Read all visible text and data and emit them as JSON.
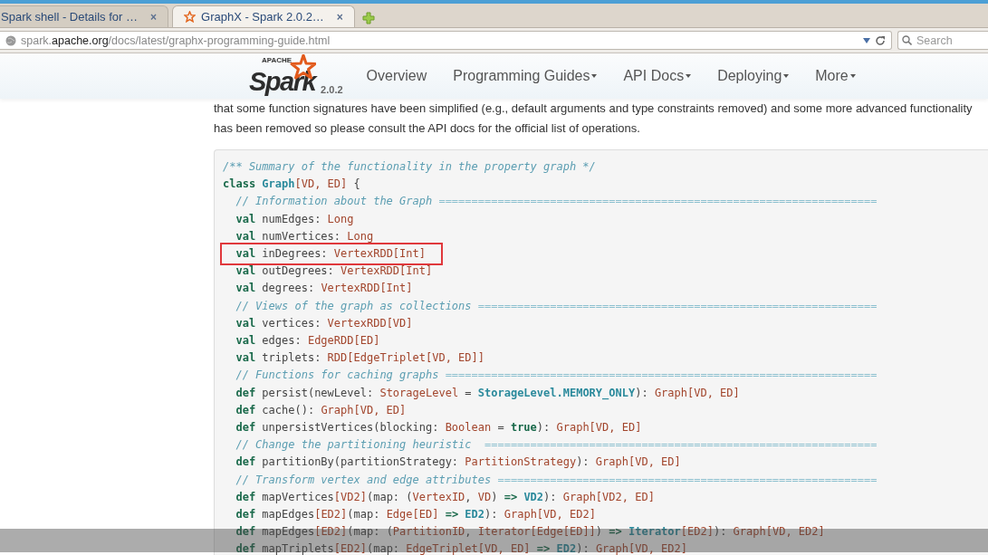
{
  "browser": {
    "tabs": [
      {
        "title": "Spark shell - Details for …",
        "close": "×",
        "selected": false,
        "favicon": false
      },
      {
        "title": "GraphX - Spark 2.0.2…",
        "close": "×",
        "selected": true,
        "favicon": true
      }
    ],
    "address": "spark.**apache.org**/docs/latest/graphx-programming-guide.html",
    "search": {
      "placeholder": "Search"
    }
  },
  "navbar": {
    "logo": {
      "brand": "APACHE",
      "name": "Spark",
      "version": "2.0.2"
    },
    "items": [
      {
        "label": "Overview",
        "dropdown": false
      },
      {
        "label": "Programming Guides",
        "dropdown": true
      },
      {
        "label": "API Docs",
        "dropdown": true
      },
      {
        "label": "Deploying",
        "dropdown": true
      },
      {
        "label": "More",
        "dropdown": true
      }
    ]
  },
  "paragraph_lines": [
    "that some function signatures have been simplified (e.g., default arguments and type constraints removed) and some more advanced functionality",
    "has been removed so please consult the API docs for the official list of operations."
  ],
  "code": {
    "lines": [
      {
        "boxed": false,
        "tokens": [
          {
            "text": "/** Summary of the functionality in the property graph */",
            "kind": "comment"
          }
        ]
      },
      {
        "boxed": false,
        "tokens": [
          {
            "text": "class ",
            "kind": "keyword"
          },
          {
            "text": "Graph",
            "kind": "name"
          },
          {
            "text": "[VD, ED]",
            "kind": "type"
          },
          {
            "text": " {",
            "kind": "plain"
          }
        ]
      },
      {
        "boxed": false,
        "tokens": [
          {
            "text": "  // Information about the Graph ",
            "kind": "comment"
          },
          {
            "text": "===================================================================",
            "kind": "rule"
          }
        ]
      },
      {
        "boxed": false,
        "tokens": [
          {
            "text": "  val",
            "kind": "keyword"
          },
          {
            "text": " numEdges: ",
            "kind": "plain"
          },
          {
            "text": "Long",
            "kind": "type"
          }
        ]
      },
      {
        "boxed": false,
        "tokens": [
          {
            "text": "  val",
            "kind": "keyword"
          },
          {
            "text": " numVertices: ",
            "kind": "plain"
          },
          {
            "text": "Long",
            "kind": "type"
          }
        ]
      },
      {
        "boxed": true,
        "tokens": [
          {
            "text": "  val",
            "kind": "keyword"
          },
          {
            "text": " inDegrees: ",
            "kind": "plain"
          },
          {
            "text": "VertexRDD[Int]",
            "kind": "type"
          }
        ]
      },
      {
        "boxed": false,
        "tokens": [
          {
            "text": "  val",
            "kind": "keyword"
          },
          {
            "text": " outDegrees: ",
            "kind": "plain"
          },
          {
            "text": "VertexRDD[Int]",
            "kind": "type"
          }
        ]
      },
      {
        "boxed": false,
        "tokens": [
          {
            "text": "  val",
            "kind": "keyword"
          },
          {
            "text": " degrees: ",
            "kind": "plain"
          },
          {
            "text": "VertexRDD[Int]",
            "kind": "type"
          }
        ]
      },
      {
        "boxed": false,
        "tokens": [
          {
            "text": "  // Views of the graph as collections ",
            "kind": "comment"
          },
          {
            "text": "=============================================================",
            "kind": "rule"
          }
        ]
      },
      {
        "boxed": false,
        "tokens": [
          {
            "text": "  val",
            "kind": "keyword"
          },
          {
            "text": " vertices: ",
            "kind": "plain"
          },
          {
            "text": "VertexRDD[VD]",
            "kind": "type"
          }
        ]
      },
      {
        "boxed": false,
        "tokens": [
          {
            "text": "  val",
            "kind": "keyword"
          },
          {
            "text": " edges: ",
            "kind": "plain"
          },
          {
            "text": "EdgeRDD[ED]",
            "kind": "type"
          }
        ]
      },
      {
        "boxed": false,
        "tokens": [
          {
            "text": "  val",
            "kind": "keyword"
          },
          {
            "text": " triplets: ",
            "kind": "plain"
          },
          {
            "text": "RDD[EdgeTriplet[VD, ED]]",
            "kind": "type"
          }
        ]
      },
      {
        "boxed": false,
        "tokens": [
          {
            "text": "  // Functions for caching graphs ",
            "kind": "comment"
          },
          {
            "text": "==================================================================",
            "kind": "rule"
          }
        ]
      },
      {
        "boxed": false,
        "tokens": [
          {
            "text": "  def",
            "kind": "keyword"
          },
          {
            "text": " persist(newLevel: ",
            "kind": "plain"
          },
          {
            "text": "StorageLevel",
            "kind": "type"
          },
          {
            "text": " = ",
            "kind": "plain"
          },
          {
            "text": "StorageLevel.MEMORY_ONLY",
            "kind": "name"
          },
          {
            "text": "): ",
            "kind": "plain"
          },
          {
            "text": "Graph[VD, ED]",
            "kind": "type"
          }
        ]
      },
      {
        "boxed": false,
        "tokens": [
          {
            "text": "  def",
            "kind": "keyword"
          },
          {
            "text": " cache(): ",
            "kind": "plain"
          },
          {
            "text": "Graph[VD, ED]",
            "kind": "type"
          }
        ]
      },
      {
        "boxed": false,
        "tokens": [
          {
            "text": "  def",
            "kind": "keyword"
          },
          {
            "text": " unpersistVertices(blocking: ",
            "kind": "plain"
          },
          {
            "text": "Boolean",
            "kind": "type"
          },
          {
            "text": " = ",
            "kind": "plain"
          },
          {
            "text": "true",
            "kind": "keyword"
          },
          {
            "text": "): ",
            "kind": "plain"
          },
          {
            "text": "Graph[VD, ED]",
            "kind": "type"
          }
        ]
      },
      {
        "boxed": false,
        "tokens": [
          {
            "text": "  // Change the partitioning heuristic  ",
            "kind": "comment"
          },
          {
            "text": "============================================================",
            "kind": "rule"
          }
        ]
      },
      {
        "boxed": false,
        "tokens": [
          {
            "text": "  def",
            "kind": "keyword"
          },
          {
            "text": " partitionBy(partitionStrategy: ",
            "kind": "plain"
          },
          {
            "text": "PartitionStrategy",
            "kind": "type"
          },
          {
            "text": "): ",
            "kind": "plain"
          },
          {
            "text": "Graph[VD, ED]",
            "kind": "type"
          }
        ]
      },
      {
        "boxed": false,
        "tokens": [
          {
            "text": "  // Transform vertex and edge attributes ",
            "kind": "comment"
          },
          {
            "text": "==========================================================",
            "kind": "rule"
          }
        ]
      },
      {
        "boxed": false,
        "tokens": [
          {
            "text": "  def",
            "kind": "keyword"
          },
          {
            "text": " mapVertices",
            "kind": "plain"
          },
          {
            "text": "[VD2]",
            "kind": "type"
          },
          {
            "text": "(map: (",
            "kind": "plain"
          },
          {
            "text": "VertexID",
            "kind": "type"
          },
          {
            "text": ", ",
            "kind": "plain"
          },
          {
            "text": "VD",
            "kind": "type"
          },
          {
            "text": ") ",
            "kind": "plain"
          },
          {
            "text": "=> ",
            "kind": "keyword"
          },
          {
            "text": "VD2",
            "kind": "name"
          },
          {
            "text": "): ",
            "kind": "plain"
          },
          {
            "text": "Graph[VD2, ED]",
            "kind": "type"
          }
        ]
      },
      {
        "boxed": false,
        "tokens": [
          {
            "text": "  def",
            "kind": "keyword"
          },
          {
            "text": " mapEdges",
            "kind": "plain"
          },
          {
            "text": "[ED2]",
            "kind": "type"
          },
          {
            "text": "(map: ",
            "kind": "plain"
          },
          {
            "text": "Edge[ED] ",
            "kind": "type"
          },
          {
            "text": "=> ",
            "kind": "keyword"
          },
          {
            "text": "ED2",
            "kind": "name"
          },
          {
            "text": "): ",
            "kind": "plain"
          },
          {
            "text": "Graph[VD, ED2]",
            "kind": "type"
          }
        ]
      },
      {
        "boxed": false,
        "tokens": [
          {
            "text": "  def",
            "kind": "keyword"
          },
          {
            "text": " mapEdges",
            "kind": "plain"
          },
          {
            "text": "[ED2]",
            "kind": "type"
          },
          {
            "text": "(map: (",
            "kind": "plain"
          },
          {
            "text": "PartitionID",
            "kind": "type"
          },
          {
            "text": ", ",
            "kind": "plain"
          },
          {
            "text": "Iterator[Edge[ED]]",
            "kind": "type"
          },
          {
            "text": ") ",
            "kind": "plain"
          },
          {
            "text": "=> ",
            "kind": "keyword"
          },
          {
            "text": "Iterator",
            "kind": "name"
          },
          {
            "text": "[ED2]",
            "kind": "type"
          },
          {
            "text": "): ",
            "kind": "plain"
          },
          {
            "text": "Graph[VD, ED2]",
            "kind": "type"
          }
        ]
      },
      {
        "boxed": false,
        "tokens": [
          {
            "text": "  def",
            "kind": "keyword"
          },
          {
            "text": " mapTriplets",
            "kind": "plain"
          },
          {
            "text": "[ED2]",
            "kind": "type"
          },
          {
            "text": "(map: ",
            "kind": "plain"
          },
          {
            "text": "EdgeTriplet[VD, ED] ",
            "kind": "type"
          },
          {
            "text": "=> ",
            "kind": "keyword"
          },
          {
            "text": "ED2",
            "kind": "name"
          },
          {
            "text": "): ",
            "kind": "plain"
          },
          {
            "text": "Graph[VD, ED2]",
            "kind": "type"
          }
        ]
      }
    ]
  }
}
